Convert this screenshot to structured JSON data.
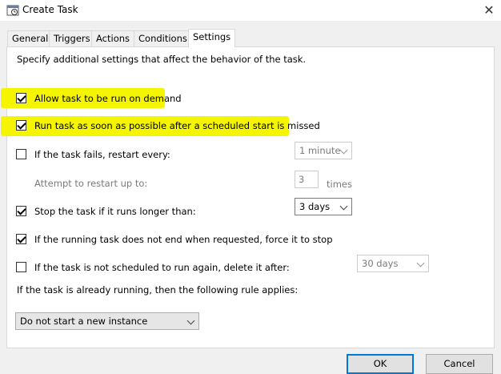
{
  "window": {
    "title": "Create Task",
    "close_glyph": "✕"
  },
  "tabs": [
    {
      "label": "General"
    },
    {
      "label": "Triggers"
    },
    {
      "label": "Actions"
    },
    {
      "label": "Conditions"
    },
    {
      "label": "Settings"
    }
  ],
  "settings": {
    "intro": "Specify additional settings that affect the behavior of the task.",
    "allow_on_demand": {
      "label": "Allow task to be run on demand",
      "checked": true
    },
    "run_asap": {
      "label": "Run task as soon as possible after a scheduled start is missed",
      "checked": true
    },
    "restart_on_fail": {
      "label": "If the task fails, restart every:",
      "checked": false,
      "interval": "1 minute"
    },
    "restart_attempts": {
      "label": "Attempt to restart up to:",
      "value": "3",
      "unit": "times"
    },
    "stop_if_longer": {
      "label": "Stop the task if it runs longer than:",
      "checked": true,
      "duration": "3 days"
    },
    "force_stop": {
      "label": "If the running task does not end when requested, force it to stop",
      "checked": true
    },
    "delete_after": {
      "label": "If the task is not scheduled to run again, delete it after:",
      "checked": false,
      "duration": "30 days"
    },
    "running_rule_label": "If the task is already running, then the following rule applies:",
    "running_rule_value": "Do not start a new instance"
  },
  "buttons": {
    "ok": "OK",
    "cancel": "Cancel"
  },
  "colors": {
    "highlight": "#f5f500",
    "accent": "#0078d7"
  }
}
